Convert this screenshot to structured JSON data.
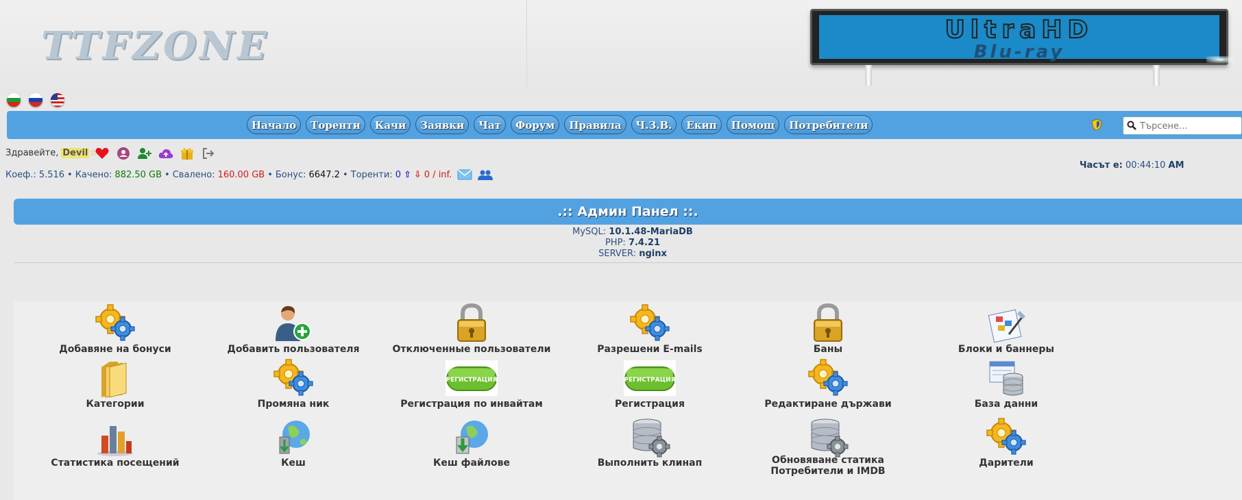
{
  "header": {
    "logo": "TTFZONE",
    "banner_top": "UltraHD",
    "banner_bottom": "Blu-ray"
  },
  "flags": [
    "bulgarian-flag",
    "russian-flag",
    "usa-flag"
  ],
  "nav": {
    "items": [
      "Начало",
      "Торенти",
      "Качи",
      "Заявки",
      "Чат",
      "Форум",
      "Правила",
      "Ч.З.В.",
      "Екип",
      "Помощ",
      "Потребители"
    ],
    "search_placeholder": "Търсене..."
  },
  "user": {
    "greeting": "Здравейте,",
    "nick": "Devil",
    "icons": [
      "heart-icon",
      "profile-icon",
      "add-user-icon",
      "upload-cloud-icon",
      "gift-icon",
      "logout-icon"
    ],
    "ratio_label": "Коеф.:",
    "ratio": "5.516",
    "uploaded_label": "Качено:",
    "uploaded": "882.50 GB",
    "downloaded_label": "Свалено:",
    "downloaded": "160.00 GB",
    "bonus_label": "Бонус:",
    "bonus": "6647.2",
    "torrents_label": "Торенти:",
    "seeding": "0",
    "leeching": "0 / inf.",
    "sep": "•",
    "time_label": "Часът е:",
    "time": "00:44:10",
    "ampm": "AM"
  },
  "panel": {
    "title": ".:: Админ Панел ::.",
    "mysql_label": "MySQL:",
    "mysql": "10.1.48-MariaDB",
    "php_label": "PHP:",
    "php": "7.4.21",
    "server_label": "SERVER:",
    "server": "nginx"
  },
  "tools": [
    {
      "label": "Добавяне на бонуси",
      "icon": "gears-icon"
    },
    {
      "label": "Добавить пользователя",
      "icon": "add-user-icon"
    },
    {
      "label": "Отключенные пользователи",
      "icon": "lock-icon"
    },
    {
      "label": "Разрешени E-mails",
      "icon": "gears-icon"
    },
    {
      "label": "Баны",
      "icon": "lock-icon"
    },
    {
      "label": "Блоки и баннеры",
      "icon": "blocks-icon"
    },
    {
      "label": "Категории",
      "icon": "folder-icon"
    },
    {
      "label": "Промяна ник",
      "icon": "gears-icon"
    },
    {
      "label": "Регистрация по инвайтам",
      "icon": "registration-icon",
      "badge": "РЕГИСТРАЦИЯ"
    },
    {
      "label": "Регистрация",
      "icon": "registration-icon",
      "badge": "РЕГИСТРАЦИЯ"
    },
    {
      "label": "Редактиране държави",
      "icon": "gears-icon"
    },
    {
      "label": "База данни",
      "icon": "database-icon"
    },
    {
      "label": "Статистика посещений",
      "icon": "bar-chart-icon"
    },
    {
      "label": "Кеш",
      "icon": "globe-cache-icon"
    },
    {
      "label": "Кеш файлове",
      "icon": "globe-download-icon"
    },
    {
      "label": "Выполнить клинап",
      "icon": "server-gear-icon"
    },
    {
      "label": "Обновяване статика Потребители и IMDB",
      "icon": "server-gear-icon"
    },
    {
      "label": "Дарители",
      "icon": "gears-icon"
    }
  ],
  "colors": {
    "nav": "#52a2e2",
    "uploaded": "#0a7a0a",
    "downloaded": "#d41a1a",
    "text": "#2a4f82"
  }
}
